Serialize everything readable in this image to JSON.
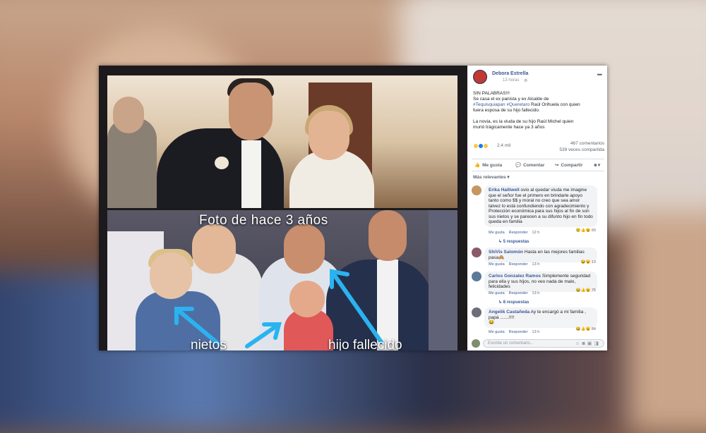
{
  "post": {
    "author": "Debora Estrella",
    "time": "13 horas",
    "body_line1": "SIN PALABRAS!!!",
    "body_line2": "Se casa el ex panista y ex Alcalde de",
    "tag1": "#Tequisquiapan",
    "tag2": "#Queretaro",
    "body_line3": " Raúl Orihuela con quien",
    "body_line4": "fuera esposa de su hijo fallecido.",
    "body_line5": "La novia, es la viuda de su hijo Raúl Michel quien",
    "body_line6": "murió trágicamente hace ya 3 años",
    "reactions_count": "2.4 mil",
    "comments_count": "467 comentarios",
    "shares_count": "539 veces compartida",
    "action_like": "Me gusta",
    "action_comment": "Comentar",
    "action_share": "Compartir",
    "sort_label": "Más relevantes ▾"
  },
  "photo": {
    "caption_top": "Foto de hace 3 años",
    "label_left": "nietos",
    "label_right": "hijo fallecido"
  },
  "comments": [
    {
      "name": "Erika Halliwell",
      "text": " ovio al quedar viuda me imagine que el señor fue el primero en brindarle apoyo tanto como $$ y moral no creo que sea amor talvez lo está confundiendo con agradecimiento y Protección económica para sus hijos al fin de son sus nietos y se parecen a su difunto hijo en fin todo queda en familia",
      "like": "Me gusta",
      "reply": "Responder",
      "time": "12 h",
      "reacts": "60",
      "replies": "5 respuestas"
    },
    {
      "name": "ShiVis Salomón",
      "text": " Hasta en las mejores familias pasa🙈",
      "like": "Me gusta",
      "reply": "Responder",
      "time": "13 h",
      "reacts": "13"
    },
    {
      "name": "Carlos Gonzalez Ramos",
      "text": " Simplemente seguridad para ella y sus hijos, no veo nada de malo, felicidades",
      "like": "Me gusta",
      "reply": "Responder",
      "time": "13 h",
      "reacts": "75",
      "replies": "8 respuestas"
    },
    {
      "name": "Angelik Castañeda",
      "text": " Ay te encargó a mi familia , papá .......!!!!",
      "extra": "😂",
      "like": "Me gusta",
      "reply": "Responder",
      "time": "13 h",
      "reacts": "84"
    }
  ],
  "input": {
    "placeholder": "Escribe un comentario..."
  },
  "colors": {
    "link": "#385898",
    "arrow": "#2bb3f0",
    "like_blue": "#1877f2",
    "haha_yellow": "#f7c948"
  }
}
